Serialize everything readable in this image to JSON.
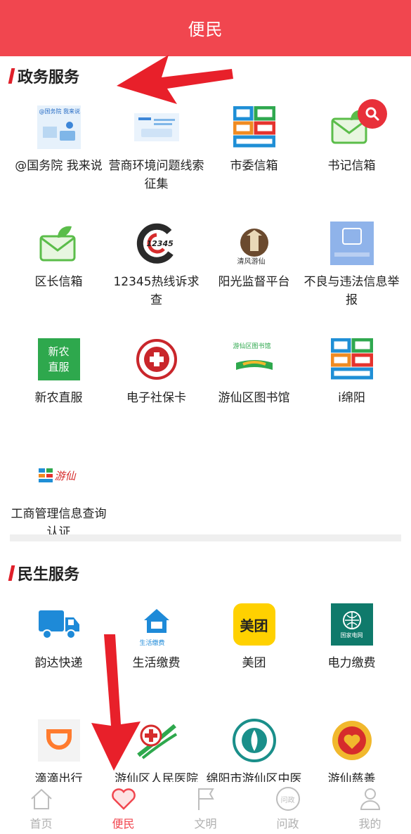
{
  "header": {
    "title": "便民"
  },
  "government": {
    "title": "政务服务",
    "items": [
      {
        "label": "@国务院 我来说",
        "icon": "guowuyuan-icon"
      },
      {
        "label": "营商环境问题线索征集",
        "icon": "business-env-icon"
      },
      {
        "label": "市委信箱",
        "icon": "mianyang-logo-icon"
      },
      {
        "label": "书记信箱",
        "icon": "secretary-mailbox-icon"
      },
      {
        "label": "区长信箱",
        "icon": "mayor-mailbox-icon"
      },
      {
        "label": "12345热线诉求查",
        "icon": "hotline-12345-icon"
      },
      {
        "label": "阳光监督平台",
        "icon": "sunshine-supervision-icon"
      },
      {
        "label": "不良与违法信息举报",
        "icon": "report-illegal-icon"
      },
      {
        "label": "新农直服",
        "icon": "xinnong-icon"
      },
      {
        "label": "电子社保卡",
        "icon": "social-security-card-icon"
      },
      {
        "label": "游仙区图书馆",
        "icon": "library-icon"
      },
      {
        "label": "i绵阳",
        "icon": "i-mianyang-icon"
      },
      {
        "label": "工商管理信息查询认证",
        "icon": "business-admin-icon"
      }
    ],
    "inner_texts": {
      "guowuyuan": "@国务院 我来说",
      "xinnong": "新农\n直服",
      "hotline": "12345",
      "sunshine": "清风游仙",
      "library": "游仙区图书馆",
      "youxian_logo": "游仙"
    }
  },
  "livelihood": {
    "title": "民生服务",
    "items": [
      {
        "label": "韵达快递",
        "icon": "truck-icon"
      },
      {
        "label": "生活缴费",
        "icon": "house-bill-icon"
      },
      {
        "label": "美团",
        "icon": "meituan-icon"
      },
      {
        "label": "电力缴费",
        "icon": "state-grid-icon"
      },
      {
        "label": "滴滴出行",
        "icon": "didi-icon"
      },
      {
        "label": "游仙区人民医院",
        "icon": "hospital-icon"
      },
      {
        "label": "绵阳市游仙区中医院",
        "icon": "tcm-hospital-icon"
      },
      {
        "label": "游仙慈善",
        "icon": "charity-icon"
      }
    ],
    "inner_texts": {
      "house_bill": "生活缴费",
      "meituan": "美团",
      "state_grid": "国家电网"
    }
  },
  "tabbar": [
    {
      "label": "首页",
      "icon": "home-icon"
    },
    {
      "label": "便民",
      "icon": "heart-icon"
    },
    {
      "label": "文明",
      "icon": "flag-icon"
    },
    {
      "label": "问政",
      "icon": "wenzheng-icon"
    },
    {
      "label": "我的",
      "icon": "user-icon"
    }
  ],
  "tab_inner": {
    "wenzheng": "问政"
  },
  "colors": {
    "brand": "#f1464f",
    "accent_bar": "#e0202a",
    "annotation_arrow": "#e8202a"
  }
}
